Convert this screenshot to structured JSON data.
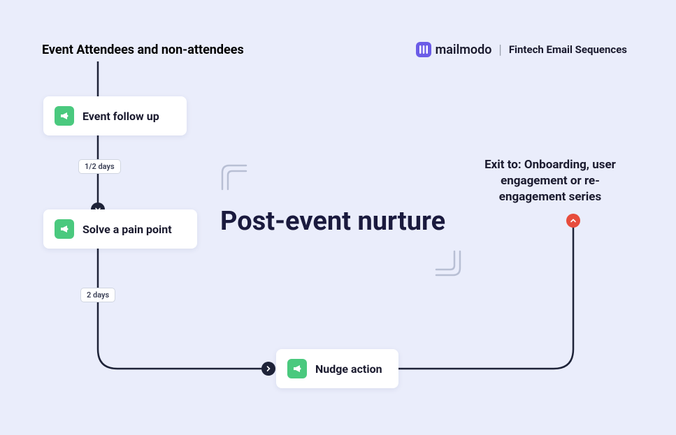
{
  "header": {
    "entry_label": "Event Attendees and non-attendees",
    "brand_name": "mailmodo",
    "brand_sub": "Fintech Email Sequences"
  },
  "steps": {
    "event_follow_up": "Event follow up",
    "solve_pain_point": "Solve a pain point",
    "nudge_action": "Nudge action"
  },
  "delays": {
    "d1": "1/2 days",
    "d2": "2 days"
  },
  "center_title": "Post-event nurture",
  "exit_label": "Exit to: Onboarding, user engagement or re-engagement series"
}
